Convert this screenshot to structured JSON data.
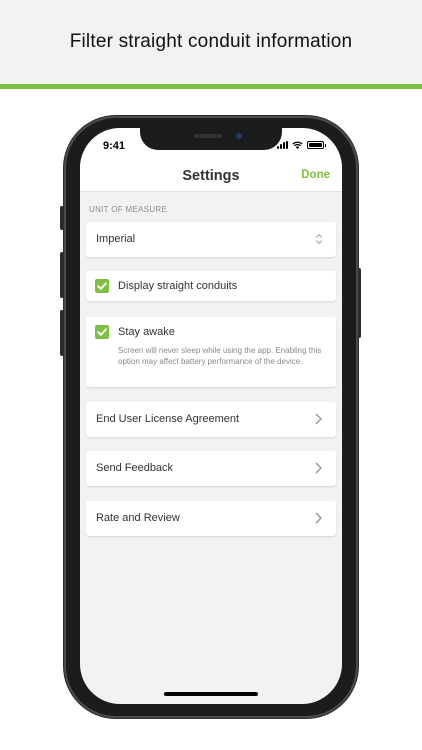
{
  "promo": {
    "title": "Filter straight conduit information"
  },
  "status_bar": {
    "time": "9:41"
  },
  "nav": {
    "title": "Settings",
    "done_label": "Done"
  },
  "settings": {
    "unit_section_header": "UNIT OF MEASURE",
    "unit_value": "Imperial",
    "display_conduits": {
      "label": "Display straight conduits",
      "checked": true
    },
    "stay_awake": {
      "label": "Stay awake",
      "description": "Screen will never sleep while using the app. Enabling this option may affect battery performance of the device.",
      "checked": true
    },
    "links": [
      {
        "label": "End User License Agreement"
      },
      {
        "label": "Send Feedback"
      },
      {
        "label": "Rate and Review"
      }
    ]
  },
  "colors": {
    "accent": "#7dc142",
    "header_bg": "#f2f2f2",
    "screen_bg": "#f2f2f4"
  },
  "icons": [
    "chevron-right-icon",
    "checkbox-checked-icon",
    "stepper-icon",
    "wifi-icon",
    "signal-icon",
    "battery-icon"
  ]
}
